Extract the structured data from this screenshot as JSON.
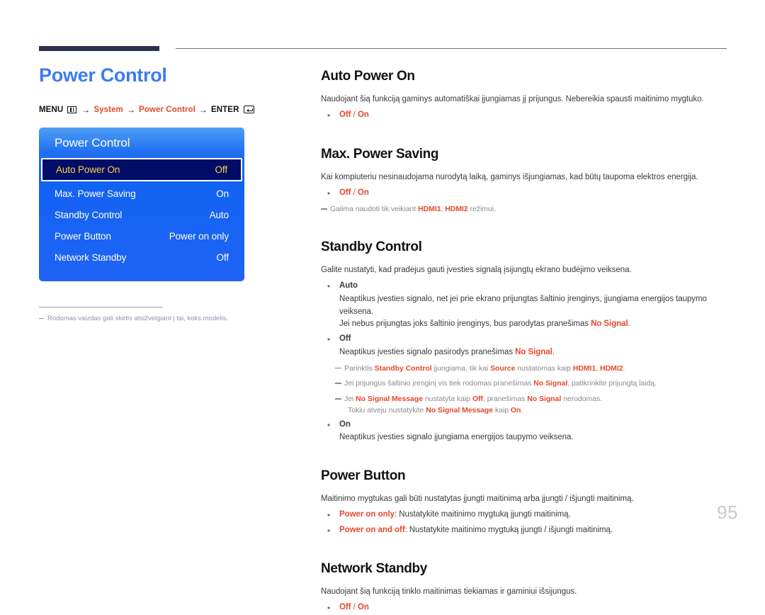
{
  "page": {
    "number": "95",
    "title": "Power Control"
  },
  "breadcrumb": {
    "menu_label": "MENU",
    "menu_icon": "menu-grid-icon",
    "arrow": "→",
    "item1": "System",
    "item2": "Power Control",
    "enter_label": "ENTER",
    "enter_icon": "enter-key-icon"
  },
  "osd": {
    "title": "Power Control",
    "rows": [
      {
        "label": "Auto Power On",
        "value": "Off",
        "selected": true
      },
      {
        "label": "Max. Power Saving",
        "value": "On",
        "selected": false
      },
      {
        "label": "Standby Control",
        "value": "Auto",
        "selected": false
      },
      {
        "label": "Power Button",
        "value": "Power on only",
        "selected": false
      },
      {
        "label": "Network Standby",
        "value": "Off",
        "selected": false
      }
    ]
  },
  "left_note": "Rodomas vaizdas gali skirtis atsižvelgiant į tai, koks modelis.",
  "sections": {
    "auto_power_on": {
      "heading": "Auto Power On",
      "body": "Naudojant šią funkciją gaminys automatiškai įjungiamas jį prijungus. Nebereikia spausti maitinimo mygtuko.",
      "opt_off": "Off",
      "opt_sep": "/",
      "opt_on": "On"
    },
    "max_power_saving": {
      "heading": "Max. Power Saving",
      "body": "Kai kompiuteriu nesinaudojama nurodytą laiką, gaminys išjungiamas, kad būtų taupoma elektros energija.",
      "opt_off": "Off",
      "opt_sep": "/",
      "opt_on": "On",
      "note_pre": "Galima naudoti tik veikiant ",
      "note_hdmi1": "HDMI1",
      "note_comma": ", ",
      "note_hdmi2": "HDMI2",
      "note_post": " režimui."
    },
    "standby_control": {
      "heading": "Standby Control",
      "body": "Galite nustatyti, kad pradėjus gauti įvesties signalą įsijungtų ekrano budėjimo veiksena.",
      "auto_label": "Auto",
      "auto_line1": "Neaptikus įvesties signalo, net jei prie ekrano prijungtas šaltinio įrenginys, įjungiama energijos taupymo veiksena.",
      "auto_line2_pre": "Jei nebus prijungtas joks šaltinio įrenginys, bus parodytas pranešimas ",
      "auto_line2_sig": "No Signal",
      "auto_line2_post": ".",
      "off_label": "Off",
      "off_line_pre": "Neaptikus įvesties signalo pasirodys pranešimas ",
      "off_line_sig": "No Signal",
      "off_line_post": ".",
      "note1_pre": "Parinktis ",
      "note1_b1": "Standby Control",
      "note1_mid": " įjungiama, tik kai ",
      "note1_b2": "Source",
      "note1_mid2": " nustatomas kaip ",
      "note1_b3": "HDMI1",
      "note1_comma": ", ",
      "note1_b4": "HDMI2",
      "note1_post": ".",
      "note2_pre": "Jei prijungus šaltinio įrenginį vis tiek rodomas pranešimas ",
      "note2_sig": "No Signal",
      "note2_post": ", patikrinkite prijungtą laidą.",
      "note3_pre": "Jei ",
      "note3_b1": "No Signal Message",
      "note3_mid": " nustatyta kaip ",
      "note3_b2": "Off",
      "note3_mid2": ", pranešimas ",
      "note3_b3": "No Signal",
      "note3_post": " nerodomas.",
      "note3_sub_pre": "Tokiu atveju nustatykite ",
      "note3_sub_b": "No Signal Message",
      "note3_sub_mid": " kaip ",
      "note3_sub_b2": "On",
      "note3_sub_post": ".",
      "on_label": "On",
      "on_line": "Neaptikus įvesties signalo įjungiama energijos taupymo veiksena."
    },
    "power_button": {
      "heading": "Power Button",
      "body": "Maitinimo mygtukas gali būti nustatytas įjungti maitinimą arba įjungti / išjungti maitinimą.",
      "opt1_label": "Power on only",
      "opt1_text": ": Nustatykite maitinimo mygtuką įjungti maitinimą.",
      "opt2_label": "Power on and off",
      "opt2_text": ": Nustatykite maitinimo mygtuką įjungti / išjungti maitinimą."
    },
    "network_standby": {
      "heading": "Network Standby",
      "body": "Naudojant šią funkciją tinklo maitinimas tiekiamas ir gaminiui išsijungus.",
      "opt_off": "Off",
      "opt_sep": "/",
      "opt_on": "On"
    }
  }
}
